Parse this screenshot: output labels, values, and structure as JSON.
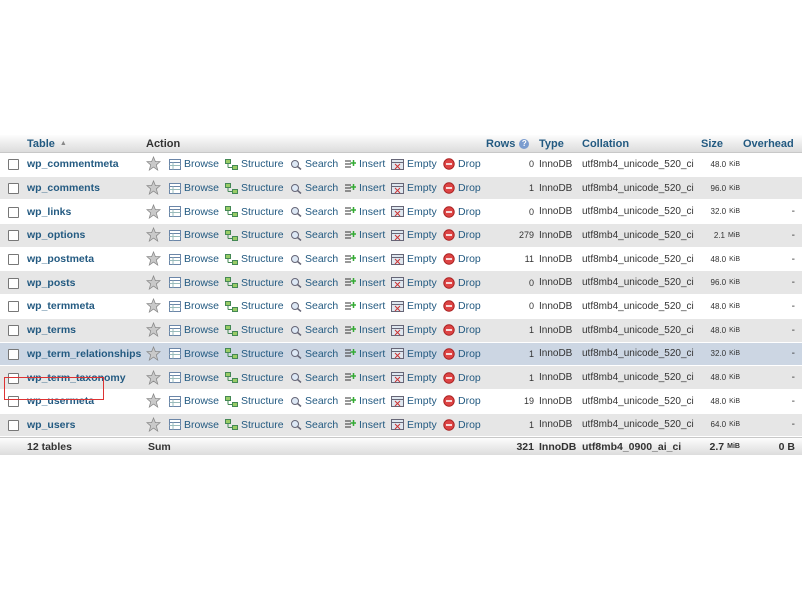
{
  "header": {
    "table": "Table",
    "action": "Action",
    "rows": "Rows",
    "type": "Type",
    "collation": "Collation",
    "size": "Size",
    "overhead": "Overhead"
  },
  "actions": {
    "browse": "Browse",
    "structure": "Structure",
    "search": "Search",
    "insert": "Insert",
    "empty": "Empty",
    "drop": "Drop"
  },
  "tables": [
    {
      "name": "wp_commentmeta",
      "rows": "0",
      "type": "InnoDB",
      "collation": "utf8mb4_unicode_520_ci",
      "size": "48.0",
      "unit": "KiB",
      "overhead": ""
    },
    {
      "name": "wp_comments",
      "rows": "1",
      "type": "InnoDB",
      "collation": "utf8mb4_unicode_520_ci",
      "size": "96.0",
      "unit": "KiB",
      "overhead": ""
    },
    {
      "name": "wp_links",
      "rows": "0",
      "type": "InnoDB",
      "collation": "utf8mb4_unicode_520_ci",
      "size": "32.0",
      "unit": "KiB",
      "overhead": "-"
    },
    {
      "name": "wp_options",
      "rows": "279",
      "type": "InnoDB",
      "collation": "utf8mb4_unicode_520_ci",
      "size": "2.1",
      "unit": "MiB",
      "overhead": "-"
    },
    {
      "name": "wp_postmeta",
      "rows": "11",
      "type": "InnoDB",
      "collation": "utf8mb4_unicode_520_ci",
      "size": "48.0",
      "unit": "KiB",
      "overhead": "-"
    },
    {
      "name": "wp_posts",
      "rows": "0",
      "type": "InnoDB",
      "collation": "utf8mb4_unicode_520_ci",
      "size": "96.0",
      "unit": "KiB",
      "overhead": "-"
    },
    {
      "name": "wp_termmeta",
      "rows": "0",
      "type": "InnoDB",
      "collation": "utf8mb4_unicode_520_ci",
      "size": "48.0",
      "unit": "KiB",
      "overhead": "-"
    },
    {
      "name": "wp_terms",
      "rows": "1",
      "type": "InnoDB",
      "collation": "utf8mb4_unicode_520_ci",
      "size": "48.0",
      "unit": "KiB",
      "overhead": "-"
    },
    {
      "name": "wp_term_relationships",
      "rows": "1",
      "type": "InnoDB",
      "collation": "utf8mb4_unicode_520_ci",
      "size": "32.0",
      "unit": "KiB",
      "overhead": "-"
    },
    {
      "name": "wp_term_taxonomy",
      "rows": "1",
      "type": "InnoDB",
      "collation": "utf8mb4_unicode_520_ci",
      "size": "48.0",
      "unit": "KiB",
      "overhead": "-"
    },
    {
      "name": "wp_usermeta",
      "rows": "19",
      "type": "InnoDB",
      "collation": "utf8mb4_unicode_520_ci",
      "size": "48.0",
      "unit": "KiB",
      "overhead": "-"
    },
    {
      "name": "wp_users",
      "rows": "1",
      "type": "InnoDB",
      "collation": "utf8mb4_unicode_520_ci",
      "size": "64.0",
      "unit": "KiB",
      "overhead": "-"
    }
  ],
  "footer": {
    "count": "12 tables",
    "sum": "Sum",
    "rows": "321",
    "type": "InnoDB",
    "collation": "utf8mb4_0900_ai_ci",
    "size": "2.7",
    "unit": "MiB",
    "overhead": "0 B"
  },
  "colors": {
    "link": "#235a81",
    "row_alt": "#e6e6e6",
    "row_highlight": "#ccd6e3",
    "selection_border": "#dd3333"
  }
}
